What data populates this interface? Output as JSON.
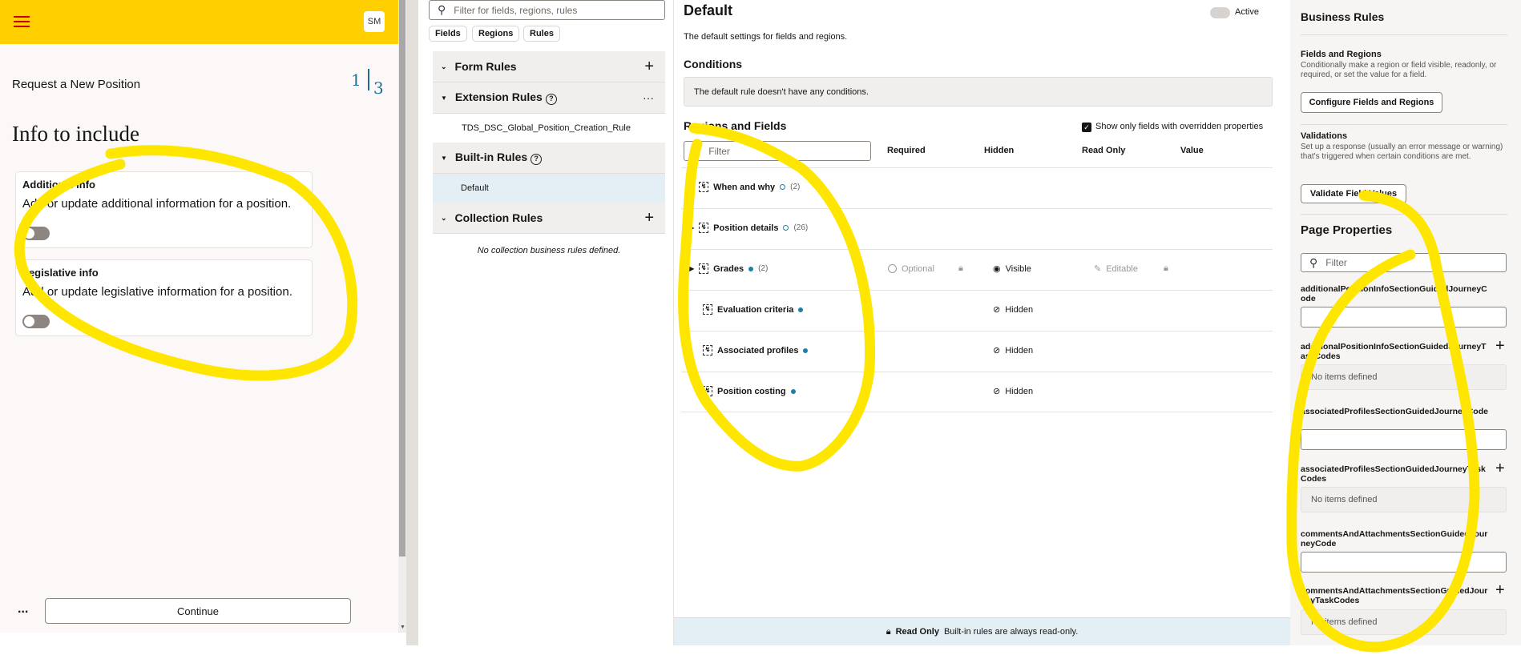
{
  "preview": {
    "avatar": "SM",
    "title": "Request a New Position",
    "step_current": "1",
    "step_total": "3",
    "heading": "Info to include",
    "cards": [
      {
        "title": "Additional info",
        "desc": "Add or update additional information for a position.",
        "enabled": false
      },
      {
        "title": "Legislative info",
        "desc": "Add or update legislative information for a position.",
        "enabled": false
      }
    ],
    "more": "...",
    "continue": "Continue"
  },
  "rules_panel": {
    "filter_placeholder": "Filter for fields, regions, rules",
    "chips": [
      "Fields",
      "Regions",
      "Rules"
    ],
    "form_rules": "Form Rules",
    "extension_rules": "Extension Rules",
    "extension_item": "TDS_DSC_Global_Position_Creation_Rule",
    "builtin_rules": "Built-in Rules",
    "builtin_item": "Default",
    "collection_rules": "Collection Rules",
    "collection_empty": "No collection business rules defined."
  },
  "main": {
    "title": "Default",
    "active_label": "Active",
    "description": "The default settings for fields and regions.",
    "conditions_title": "Conditions",
    "conditions_text": "The default rule doesn't have any conditions.",
    "regions_title": "Regions and Fields",
    "show_only_label": "Show only fields with overridden properties",
    "show_only_checked": true,
    "filter_placeholder": "Filter",
    "columns": [
      "Required",
      "Hidden",
      "Read Only",
      "Value"
    ],
    "rows": [
      {
        "name": "When and why",
        "count": "(2)"
      },
      {
        "name": "Position details",
        "count": "(26)"
      },
      {
        "name": "Grades",
        "count": "(2)",
        "required": "Optional",
        "hidden": "Visible",
        "readonly": "Editable"
      },
      {
        "name": "Evaluation criteria",
        "hidden": "Hidden"
      },
      {
        "name": "Associated profiles",
        "hidden": "Hidden"
      },
      {
        "name": "Position costing",
        "hidden": "Hidden"
      }
    ],
    "footer_bold": "Read Only",
    "footer_text": "Built-in rules are always read-only."
  },
  "right": {
    "title": "Business Rules",
    "fr_title": "Fields and Regions",
    "fr_desc": "Conditionally make a region or field visible, readonly, or required, or set the value for a field.",
    "fr_button": "Configure Fields and Regions",
    "val_title": "Validations",
    "val_desc": "Set up a response (usually an error message or warning) that's triggered when certain conditions are met.",
    "val_button": "Validate Field Values",
    "pp_title": "Page Properties",
    "pp_filter": "Filter",
    "props": [
      "additionalPositionInfoSectionGuidedJourneyCode",
      "additionalPositionInfoSectionGuidedJourneyTaskCodes",
      "associatedProfilesSectionGuidedJourneyCode",
      "associatedProfilesSectionGuidedJourneyTaskCodes",
      "commentsAndAttachmentsSectionGuidedJourneyCode",
      "commentsAndAttachmentsSectionGuidedJourneyTaskCodes"
    ],
    "no_items": "No items defined"
  },
  "colors": {
    "header": "#ffcf00",
    "accent": "#1d7fa6",
    "annotation": "#ffe600"
  }
}
